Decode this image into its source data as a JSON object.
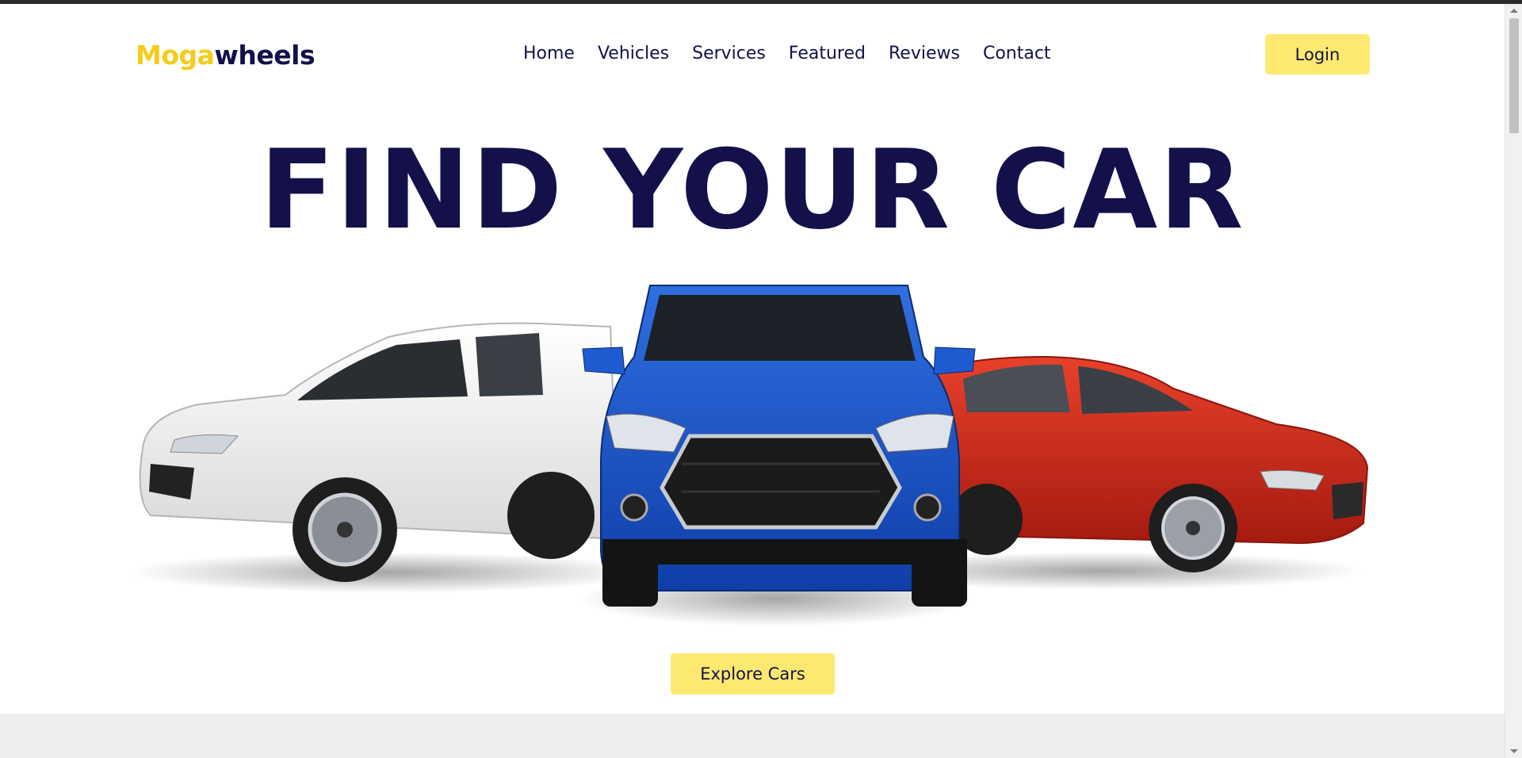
{
  "header": {
    "logo_part1": "Moga",
    "logo_part2": "wheels",
    "nav": [
      "Home",
      "Vehicles",
      "Services",
      "Featured",
      "Reviews",
      "Contact"
    ],
    "login_label": "Login"
  },
  "hero": {
    "title": "FIND YOUR CAR",
    "cta_label": "Explore Cars",
    "cars": [
      "white-suv",
      "blue-suv",
      "red-sedan"
    ]
  },
  "colors": {
    "brand_yellow": "#f5cc1c",
    "button_yellow": "#fde96f",
    "navy": "#13104a"
  }
}
